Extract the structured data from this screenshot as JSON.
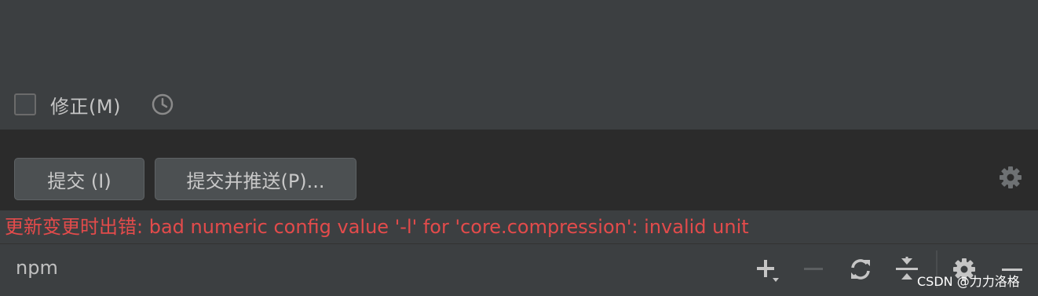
{
  "amend": {
    "label": "修正(M)",
    "checked": false,
    "icons": [
      "history-icon"
    ]
  },
  "commit_buttons": {
    "commit_label": "提交 (I)",
    "commit_push_label": "提交并推送(P)..."
  },
  "error": {
    "message": "更新变更时出错: bad numeric config value '-l' for 'core.compression': invalid unit",
    "color": "#e34b4b"
  },
  "bottom_toolbar": {
    "label": "npm",
    "icons": [
      "add-icon",
      "remove-icon",
      "refresh-icon",
      "collapse-all-icon",
      "gear-icon",
      "minimize-icon"
    ]
  },
  "watermark": {
    "text": "CSDN @力力洛格"
  }
}
